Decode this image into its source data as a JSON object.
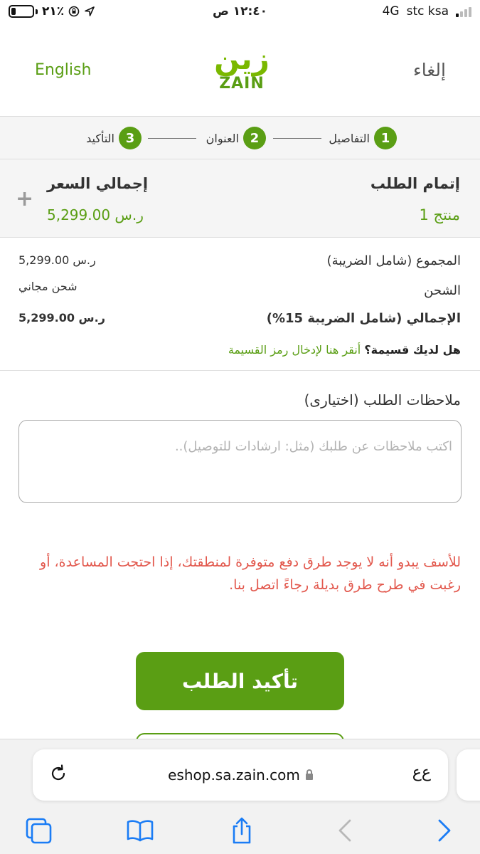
{
  "status_bar": {
    "battery_percent": "٢١٪",
    "battery_level": 0.21,
    "time": "١٢:٤٠ ص",
    "network": "4G",
    "carrier": "stc ksa"
  },
  "header": {
    "language_link": "English",
    "cancel_label": "إلغاء",
    "logo_glyph": "زين",
    "logo_text": "ZAIN"
  },
  "steps": [
    {
      "number": "1",
      "label": "التفاصيل"
    },
    {
      "number": "2",
      "label": "العنوان"
    },
    {
      "number": "3",
      "label": "التأكيد"
    }
  ],
  "summary": {
    "title": "إتمام الطلب",
    "product_count": "1 منتج",
    "total_title": "إجمالي السعر",
    "total_value": "5,299.00 ر.س"
  },
  "breakdown": {
    "subtotal_label": "المجموع (شامل الضريبة)",
    "subtotal_value": "5,299.00 ر.س",
    "shipping_label": "الشحن",
    "shipping_value": "شحن مجاني",
    "total_label": "الإجمالي (شامل الضريبة 15%)",
    "total_value": "5,299.00 ر.س"
  },
  "coupon": {
    "question": "هل لديك قسيمة؟",
    "link": "أنقر هنا لإدخال رمز القسيمة"
  },
  "notes": {
    "label": "ملاحظات الطلب (اختيارى)",
    "placeholder": "اكتب ملاحظات عن طلبك (مثل: ارشادات للتوصيل).."
  },
  "error_message": "للأسف يبدو أنه لا يوجد طرق دفع متوفرة لمنطقتك، إذا احتجت المساعدة، أو رغبت في طرح طرق بديلة رجاءً اتصل بنا.",
  "confirm_button": "تأكيد الطلب",
  "browser": {
    "url": "eshop.sa.zain.com",
    "text_size_button": "ﻉﻉ"
  },
  "colors": {
    "brand_green": "#5a9e14",
    "error_red": "#e2574c"
  }
}
